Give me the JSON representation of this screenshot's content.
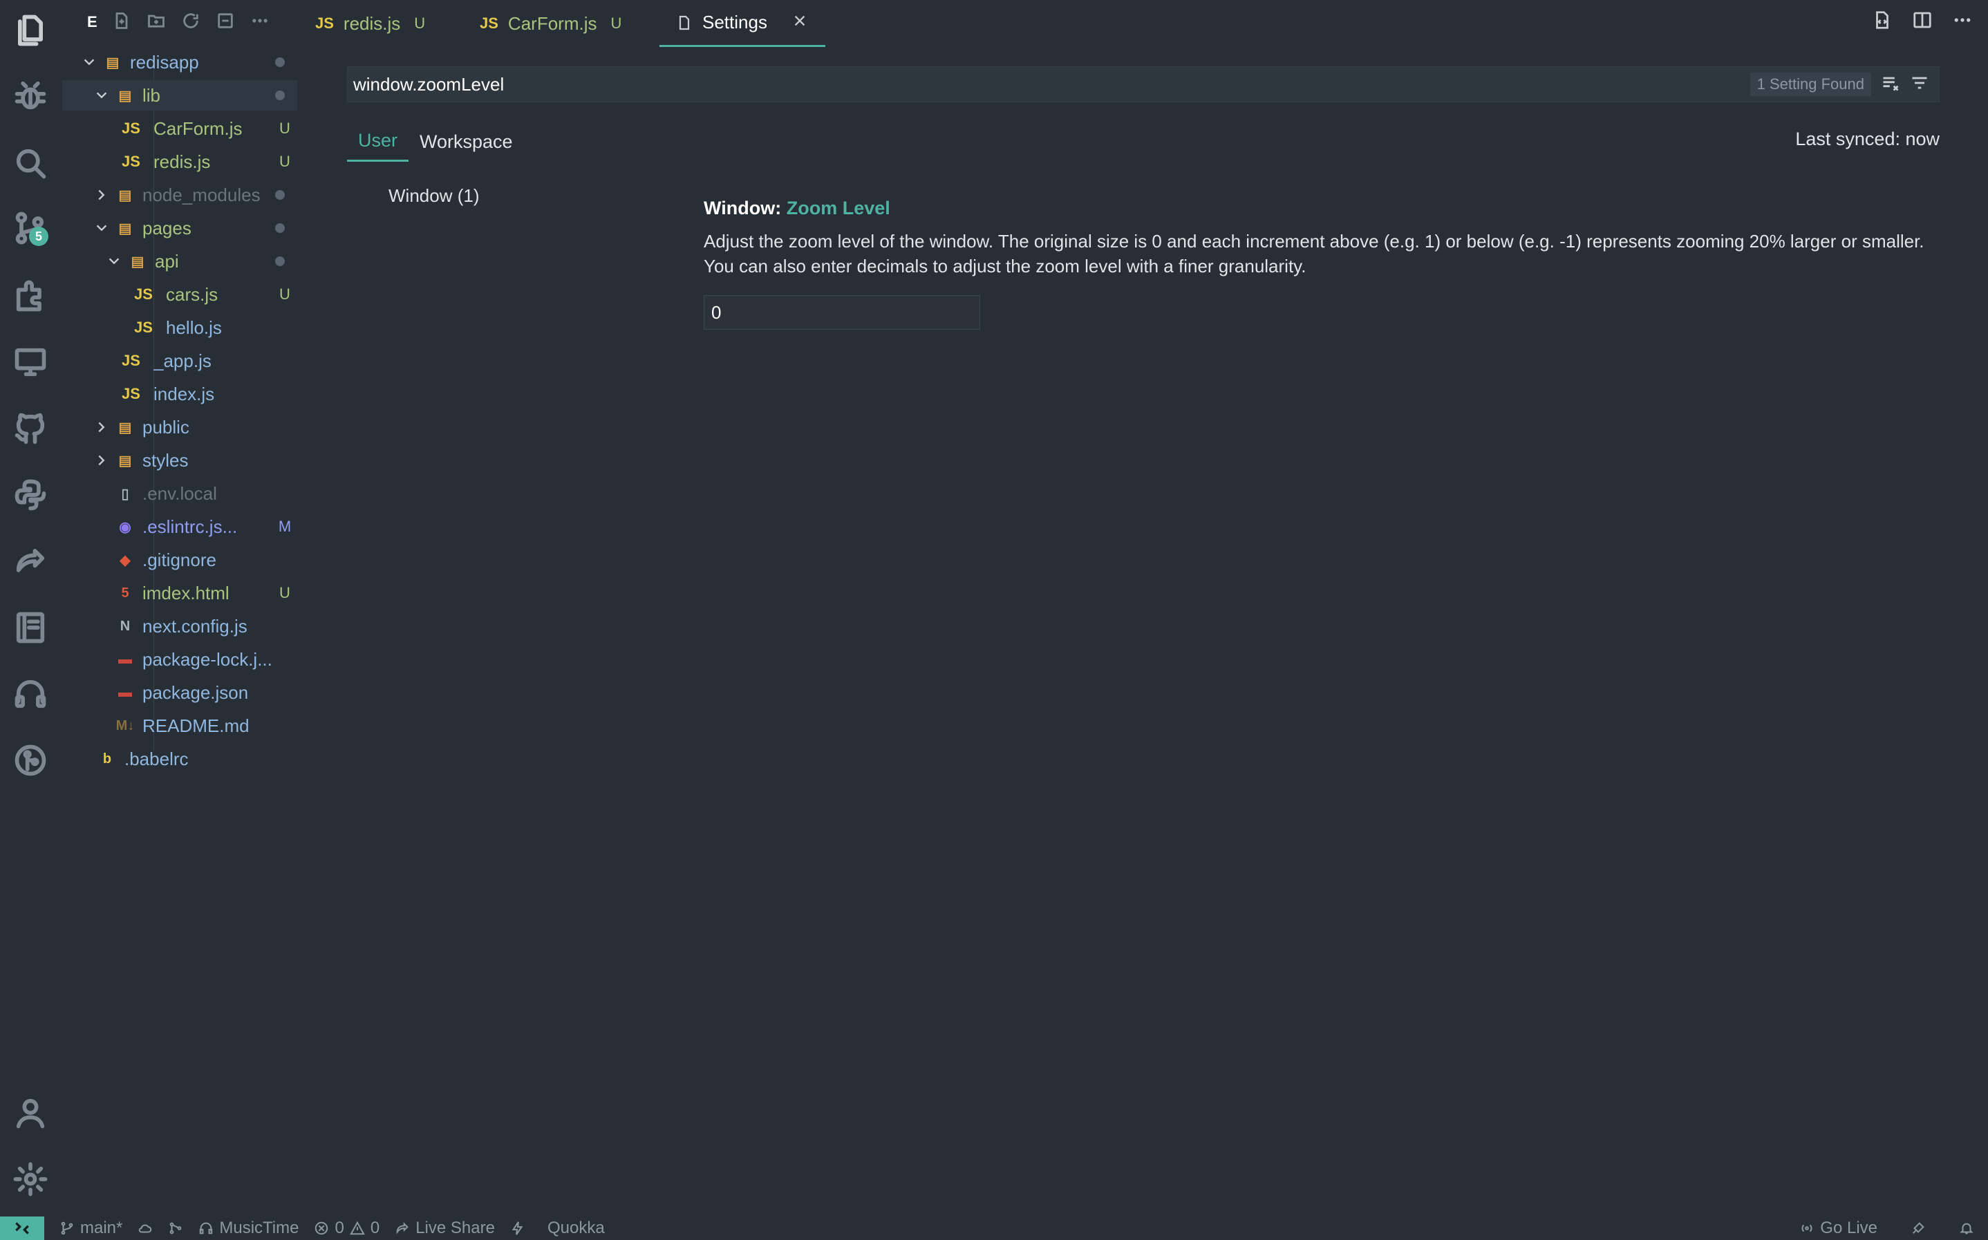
{
  "activity_bar": {
    "source_control_badge": "5"
  },
  "explorer": {
    "title": "E",
    "tree": [
      {
        "name": "redisapp",
        "kind": "folder",
        "expanded": true,
        "level": 0,
        "decoration": "dot",
        "color": "blue"
      },
      {
        "name": "lib",
        "kind": "folder",
        "expanded": true,
        "level": 1,
        "decoration": "dot",
        "color": "green",
        "selected": true
      },
      {
        "name": "CarForm.js",
        "kind": "js",
        "level": 2,
        "decoration": "U",
        "color": "green"
      },
      {
        "name": "redis.js",
        "kind": "js",
        "level": 2,
        "decoration": "U",
        "color": "green"
      },
      {
        "name": "node_modules",
        "kind": "folder",
        "expanded": false,
        "level": 1,
        "decoration": "dot",
        "color": "dim"
      },
      {
        "name": "pages",
        "kind": "folder",
        "expanded": true,
        "level": 1,
        "decoration": "dot",
        "color": "green"
      },
      {
        "name": "api",
        "kind": "folder",
        "expanded": true,
        "level": 2,
        "decoration": "dot",
        "color": "green"
      },
      {
        "name": "cars.js",
        "kind": "js",
        "level": 3,
        "decoration": "U",
        "color": "green"
      },
      {
        "name": "hello.js",
        "kind": "js",
        "level": 3,
        "decoration": "",
        "color": "blue"
      },
      {
        "name": "_app.js",
        "kind": "js",
        "level": 2,
        "decoration": "",
        "color": "blue"
      },
      {
        "name": "index.js",
        "kind": "js",
        "level": 2,
        "decoration": "",
        "color": "blue"
      },
      {
        "name": "public",
        "kind": "folder",
        "expanded": false,
        "level": 1,
        "decoration": "",
        "color": "blue"
      },
      {
        "name": "styles",
        "kind": "folder",
        "expanded": false,
        "level": 1,
        "decoration": "",
        "color": "blue"
      },
      {
        "name": ".env.local",
        "kind": "file",
        "level": 1,
        "decoration": "",
        "color": "dim"
      },
      {
        "name": ".eslintrc.js...",
        "kind": "eslint",
        "level": 1,
        "decoration": "M",
        "color": "mod"
      },
      {
        "name": ".gitignore",
        "kind": "git",
        "level": 1,
        "decoration": "",
        "color": "blue"
      },
      {
        "name": "imdex.html",
        "kind": "html",
        "level": 1,
        "decoration": "U",
        "color": "green"
      },
      {
        "name": "next.config.js",
        "kind": "next",
        "level": 1,
        "decoration": "",
        "color": "blue"
      },
      {
        "name": "package-lock.j...",
        "kind": "npm",
        "level": 1,
        "decoration": "",
        "color": "blue"
      },
      {
        "name": "package.json",
        "kind": "npm",
        "level": 1,
        "decoration": "",
        "color": "blue"
      },
      {
        "name": "README.md",
        "kind": "md",
        "level": 1,
        "decoration": "",
        "color": "blue"
      },
      {
        "name": ".babelrc",
        "kind": "babel",
        "level": 0,
        "decoration": "",
        "color": "blue"
      }
    ]
  },
  "tabs": [
    {
      "label": "redis.js",
      "icon": "JS",
      "badge": "U",
      "active": false
    },
    {
      "label": "CarForm.js",
      "icon": "JS",
      "badge": "U",
      "active": false
    },
    {
      "label": "Settings",
      "icon": "file-icon",
      "badge": "",
      "active": true
    }
  ],
  "settings": {
    "search_value": "window.zoomLevel",
    "found_count": "1 Setting Found",
    "scopes": [
      "User",
      "Workspace"
    ],
    "last_synced": "Last synced: now",
    "toc_item": "Window (1)",
    "setting_category": "Window: ",
    "setting_key": "Zoom Level",
    "setting_description": "Adjust the zoom level of the window. The original size is 0 and each increment above (e.g. 1) or below (e.g. -1) represents zooming 20% larger or smaller. You can also enter decimals to adjust the zoom level with a finer granularity.",
    "setting_value": "0"
  },
  "status_bar": {
    "branch": "main*",
    "music": "MusicTime",
    "errors": "0",
    "warnings": "0",
    "live_share": "Live Share",
    "quokka": "Quokka",
    "go_live": "Go Live"
  },
  "colors": {
    "accent": "#4fb3a1",
    "background": "#272e35",
    "untracked": "#a9c47f",
    "js_icon": "#e6c84a"
  }
}
